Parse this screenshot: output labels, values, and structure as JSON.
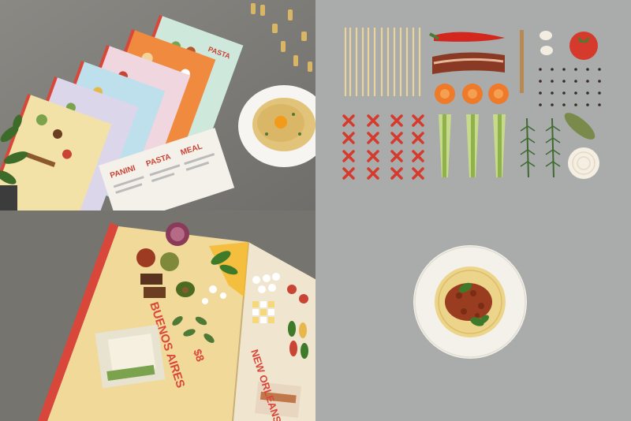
{
  "image": {
    "colors": {
      "table": "#7f7e79",
      "backdrop": "#a9acab",
      "menu_spine": "#d9473a",
      "tomato": "#d63a2c",
      "carrot": "#ef7a2a",
      "pasta": "#e9d49a"
    }
  },
  "menu_closed": {
    "labels": [
      "PANINI",
      "PASTA",
      "MEAL"
    ]
  },
  "menu_open": {
    "city_top": "BUENOS AIRES",
    "price": "$8",
    "city_bottom": "NEW ORLEANS"
  }
}
